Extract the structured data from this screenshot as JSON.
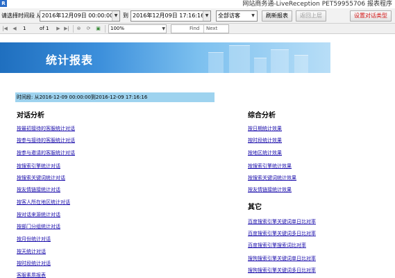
{
  "window": {
    "title": "网站商务通-LiveReception PET59955706  报表程序",
    "icon": "R"
  },
  "toolbar": {
    "period_label": "请选择时间段 从",
    "from_value": "2016年12月09日 00:00:00",
    "to_label": "到",
    "to_value": "2016年12月09日 17:16:16",
    "visitor_filter": "全部访客",
    "refresh_button": "刷新报表",
    "back_button": "返回上层",
    "settings_button": "设置对话类型"
  },
  "viewer": {
    "page": "1",
    "of_label": "of 1",
    "zoom": "100%",
    "find_label": "Find",
    "next_label": "Next"
  },
  "report": {
    "banner_title": "统计报表",
    "time_range": "时间段: 从2016-12-09 00:00:00到2016-12-09 17:16:16",
    "left": {
      "heading": "对话分析",
      "links": [
        "按最初接待的客服统计对话",
        "按参与接待的客服统计对话",
        "按参与邀请的客服统计对话",
        "按搜索引擎统计对话",
        "按搜索关键词统计对话",
        "按友情链接统计对话",
        "按客人所在地区统计对话",
        "按对话来源统计对话",
        "按部门分组统计对话",
        "按月份统计对话",
        "按天统计对话",
        "按时段统计对话",
        "客服素质报表"
      ]
    },
    "right": {
      "heading1": "综合分析",
      "links1": [
        "按日期统计效果",
        "按时段统计效果",
        "按地区统计效果",
        "按搜索引擎统计效果",
        "按搜索关键词统计效果",
        "按友情链接统计效果"
      ],
      "heading2": "其它",
      "links2": [
        "百度搜索引擎关键词单日比对率",
        "百度搜索引擎关键词多日比对率",
        "百度搜索引擎搜索词比对率",
        "搜狗搜索引擎关键词单日比对率",
        "搜狗搜索引擎关键词多日比对率"
      ]
    }
  },
  "colors": {
    "timebar": "#9ed3ef",
    "link": "#1a0dab",
    "banner": "#3c8fdb"
  }
}
